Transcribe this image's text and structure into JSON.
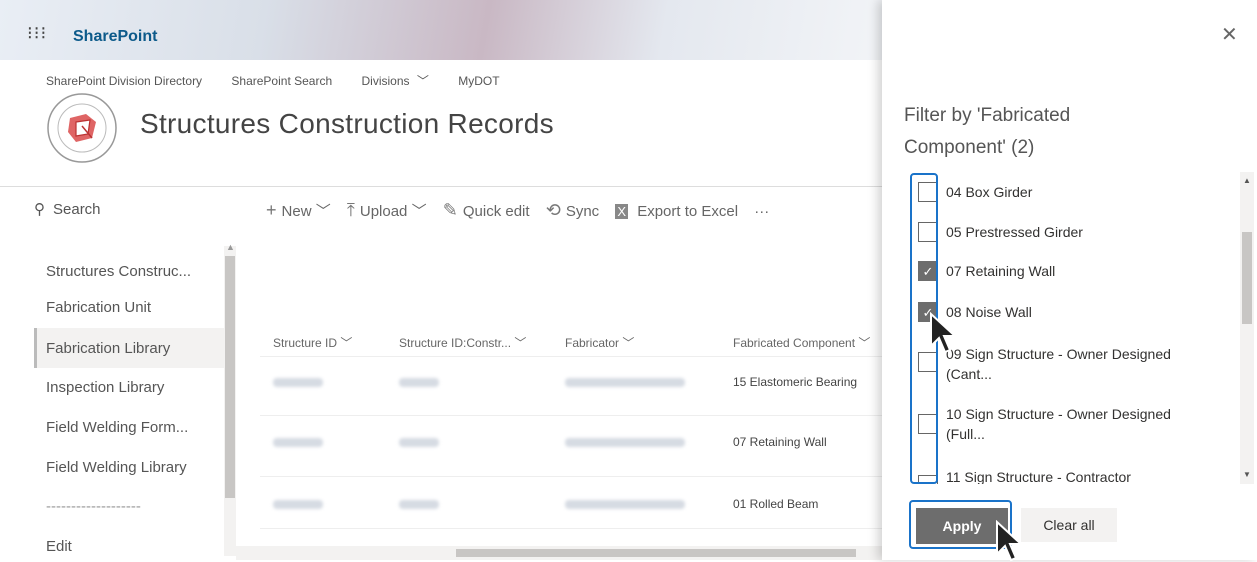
{
  "app": {
    "name": "SharePoint"
  },
  "hub_nav": [
    "SharePoint Division Directory",
    "SharePoint Search",
    "Divisions",
    "MyDOT"
  ],
  "site": {
    "title": "Structures Construction Records"
  },
  "search": {
    "placeholder": "Search"
  },
  "command_bar": {
    "new": "New",
    "upload": "Upload",
    "quick_edit": "Quick edit",
    "sync": "Sync",
    "export": "Export to Excel",
    "more": "···"
  },
  "left_nav": {
    "items": [
      "Structures Construc...",
      "Fabrication Unit",
      "Fabrication Library",
      "Inspection Library",
      "Field Welding Form...",
      "Field Welding Library",
      "-------------------",
      "Edit"
    ],
    "selected": "Fabrication Library"
  },
  "table": {
    "columns": [
      "Structure ID",
      "Structure ID:Constr...",
      "Fabricator",
      "Fabricated Component"
    ],
    "rows": [
      {
        "fabricated_component": "15 Elastomeric Bearing"
      },
      {
        "fabricated_component": "07 Retaining Wall"
      },
      {
        "fabricated_component": "01 Rolled Beam"
      }
    ]
  },
  "filter_panel": {
    "title": "Filter by 'Fabricated Component' (2)",
    "options": [
      {
        "line1": "04 Box Girder",
        "line2": "",
        "checked": false
      },
      {
        "line1": "05 Prestressed Girder",
        "line2": "",
        "checked": false
      },
      {
        "line1": "07 Retaining Wall",
        "line2": "",
        "checked": true
      },
      {
        "line1": "08 Noise Wall",
        "line2": "",
        "checked": true
      },
      {
        "line1": "09 Sign Structure - Owner Designed",
        "line2": "(Cant...",
        "checked": false
      },
      {
        "line1": "10 Sign Structure - Owner Designed",
        "line2": "(Full...",
        "checked": false
      },
      {
        "line1": "11 Sign Structure - Contractor",
        "line2": "",
        "checked": false
      }
    ],
    "apply_label": "Apply",
    "clear_label": "Clear all",
    "close_icon": "close-icon"
  },
  "colors": {
    "brand": "#0c5a8a",
    "highlight": "#1a73c9",
    "checked": "#6d6d6d"
  }
}
